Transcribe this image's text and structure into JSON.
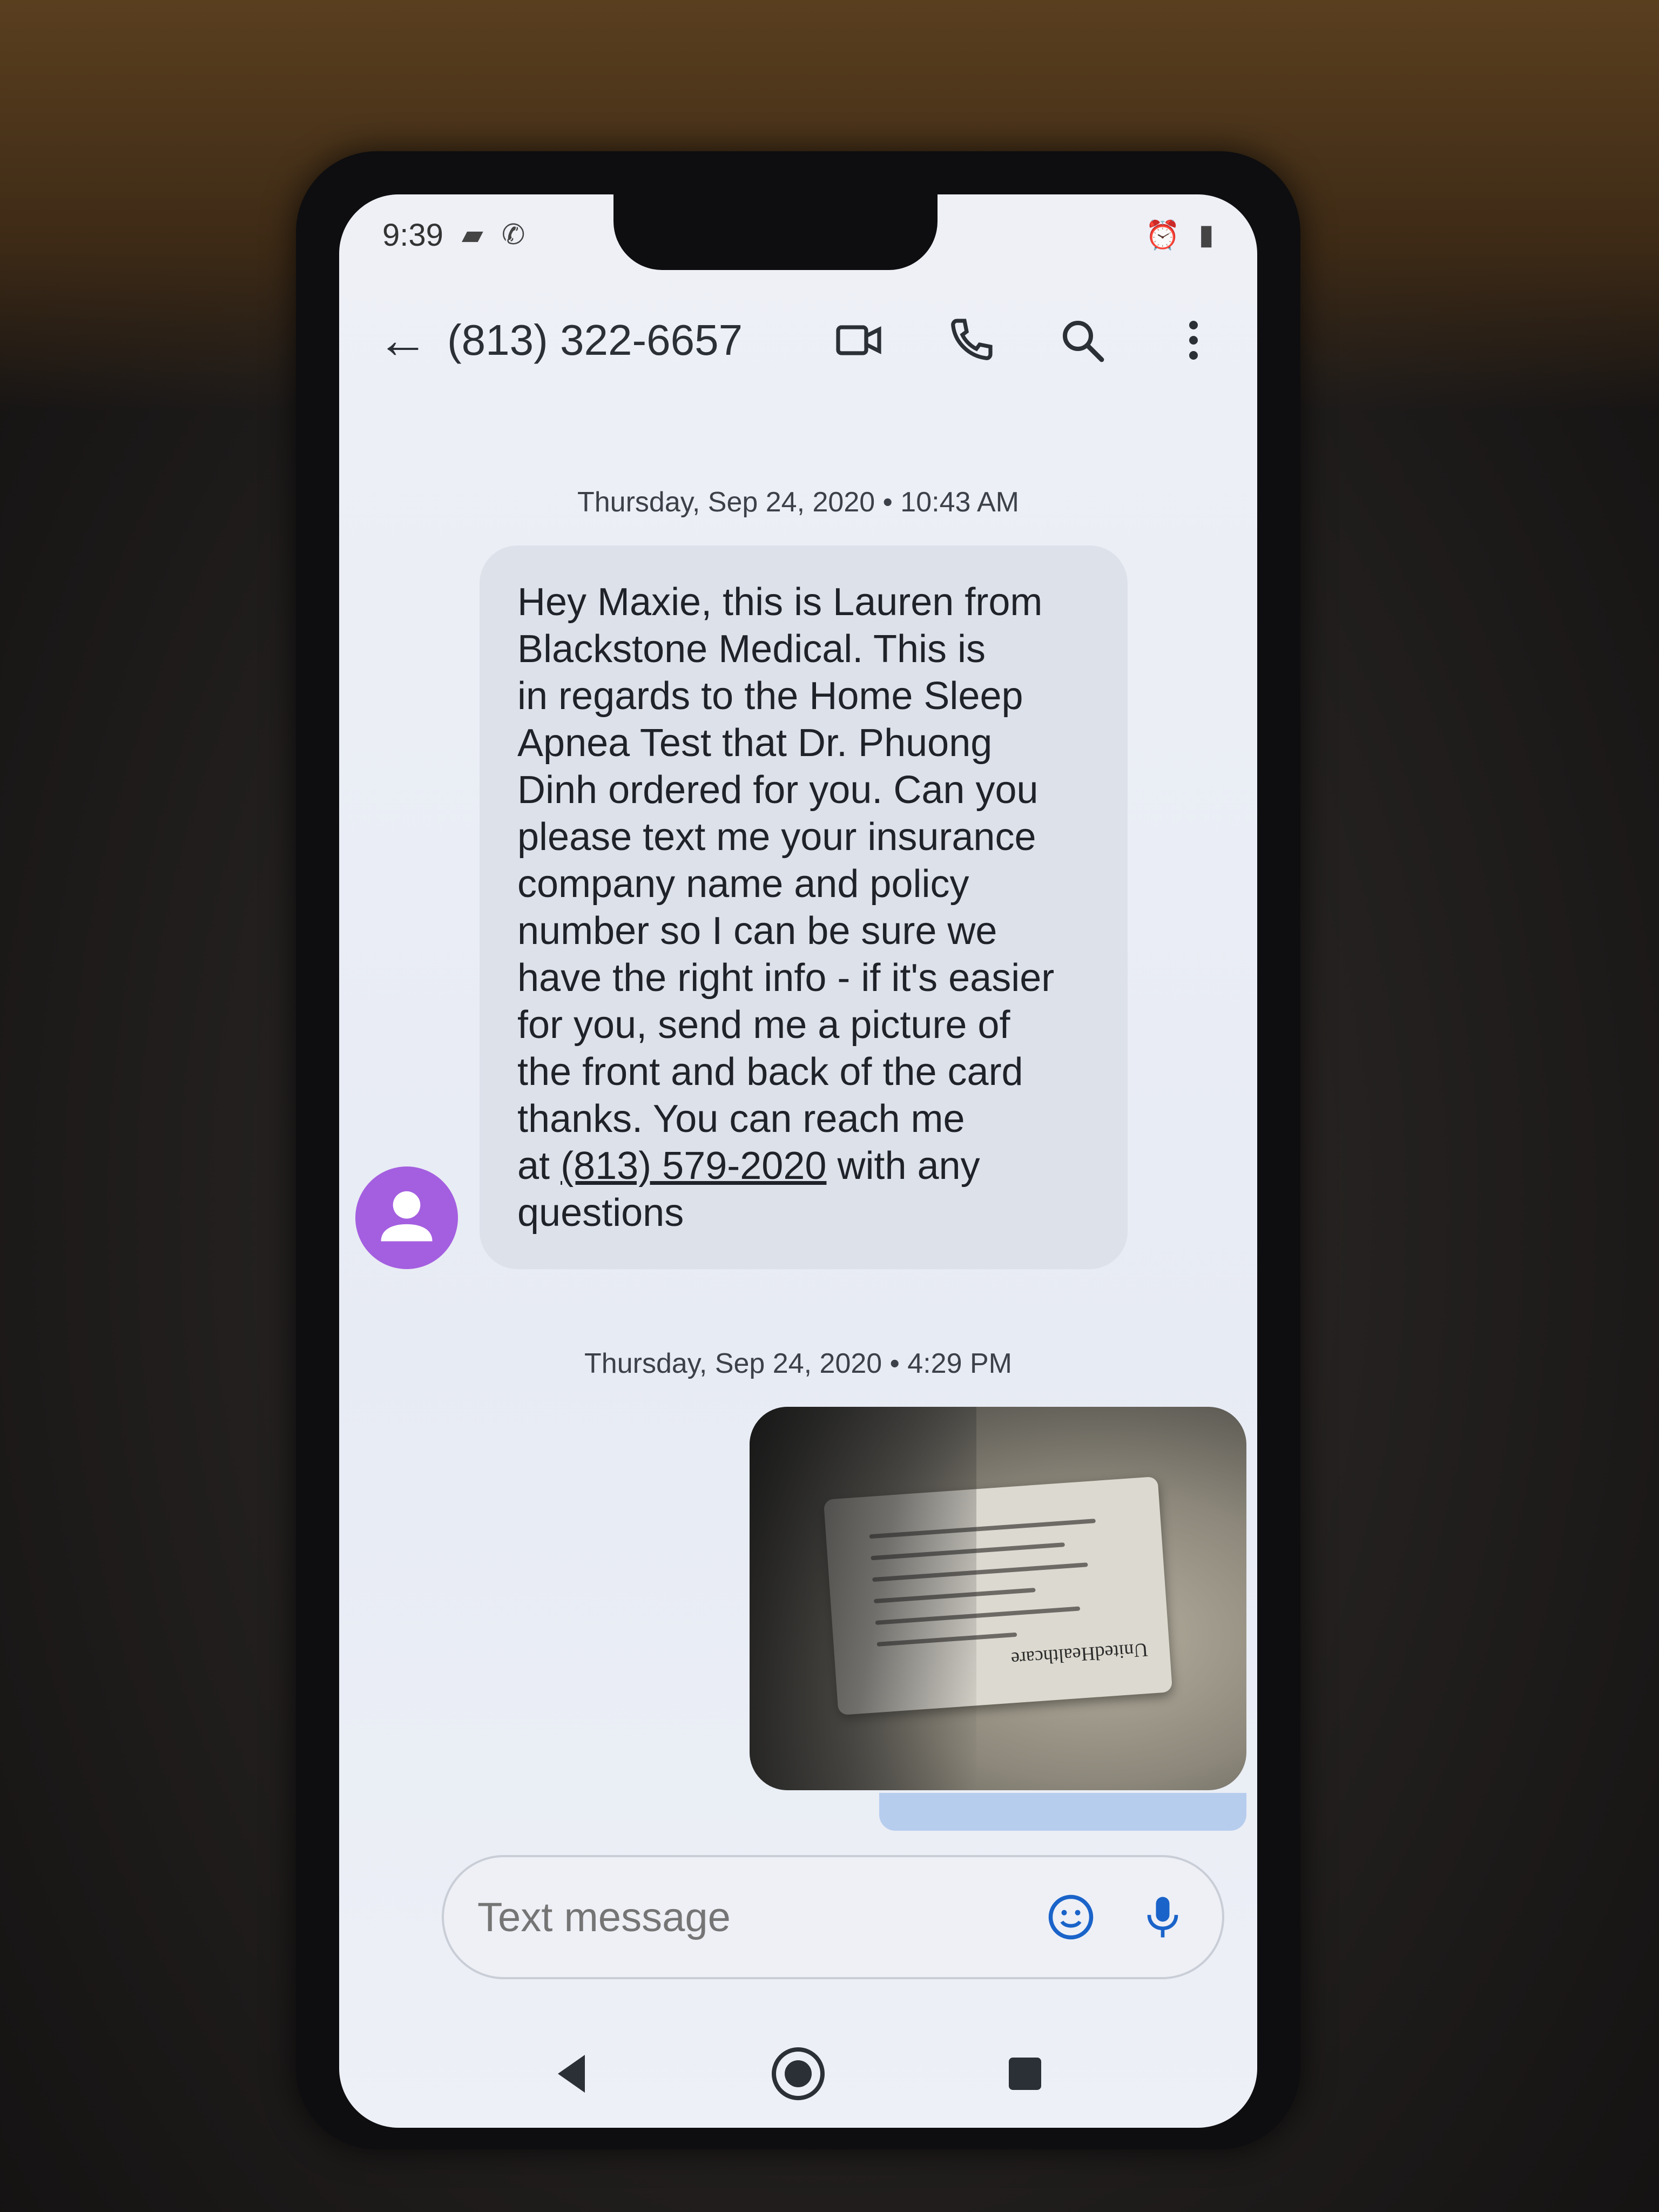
{
  "status_bar": {
    "time": "9:39"
  },
  "header": {
    "contact": "(813) 322-6657"
  },
  "messages": [
    {
      "timestamp": "Thursday, Sep 24, 2020 • 10:43 AM",
      "lines": [
        "Hey Maxie, this is Lauren from",
        "Blackstone Medical. This is",
        "in regards to the Home Sleep",
        "Apnea Test that Dr. Phuong",
        "Dinh ordered for you. Can you",
        "please text me your insurance",
        "company name and policy",
        "number so I can be sure we",
        "have the right info - if it's easier",
        "for you, send me a picture of",
        "the front and back of the card",
        "thanks. You can reach me"
      ],
      "last_line_prefix": "at ",
      "link": "(813) 579-2020",
      "last_line_suffix": " with any",
      "final_line": "questions"
    },
    {
      "timestamp": "Thursday, Sep 24, 2020 • 4:29 PM",
      "card_brand": "UnitedHealthcare"
    }
  ],
  "compose": {
    "placeholder": "Text message"
  },
  "colors": {
    "avatar": "#a45fe0",
    "accent": "#1a63c9",
    "sent_bubble": "#b7cdee"
  }
}
